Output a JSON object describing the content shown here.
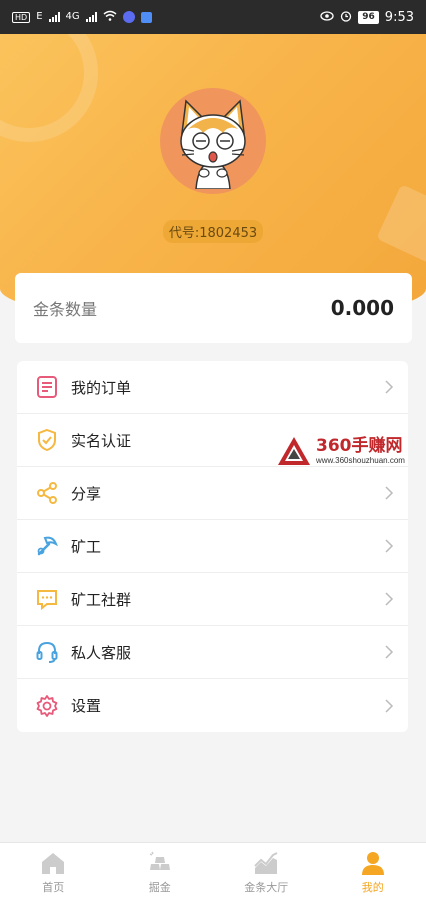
{
  "status_bar": {
    "left_hd": "HD",
    "left_net1": "E",
    "left_net2": "4G",
    "battery": "96",
    "time": "9:53"
  },
  "profile": {
    "code": "代号:1802453",
    "avatar_icon": "cat-avatar-icon"
  },
  "gold": {
    "label": "金条数量",
    "value": "0.000"
  },
  "menu": {
    "items": [
      {
        "label": "我的订单",
        "icon": "order-list-icon",
        "color": "#e85a7a"
      },
      {
        "label": "实名认证",
        "icon": "shield-check-icon",
        "color": "#f5b942"
      },
      {
        "label": "分享",
        "icon": "share-icon",
        "color": "#f5b942"
      },
      {
        "label": "矿工",
        "icon": "pickaxe-icon",
        "color": "#4aa3df"
      },
      {
        "label": "矿工社群",
        "icon": "chat-bubble-icon",
        "color": "#f5b942"
      },
      {
        "label": "私人客服",
        "icon": "headset-icon",
        "color": "#4aa3df"
      },
      {
        "label": "设置",
        "icon": "gear-icon",
        "color": "#e85a7a"
      }
    ]
  },
  "watermark": {
    "main": "360手赚网",
    "sub": "www.360shouzhuan.com"
  },
  "nav": {
    "items": [
      {
        "label": "首页",
        "icon": "home-icon"
      },
      {
        "label": "掘金",
        "icon": "gold-bars-icon"
      },
      {
        "label": "金条大厅",
        "icon": "trend-chart-icon"
      },
      {
        "label": "我的",
        "icon": "user-icon",
        "active": true
      }
    ]
  },
  "colors": {
    "header_gradient_start": "#fbc35c",
    "header_gradient_end": "#f3a73a",
    "accent": "#f5a623",
    "avatar_bg": "#f0965c"
  }
}
